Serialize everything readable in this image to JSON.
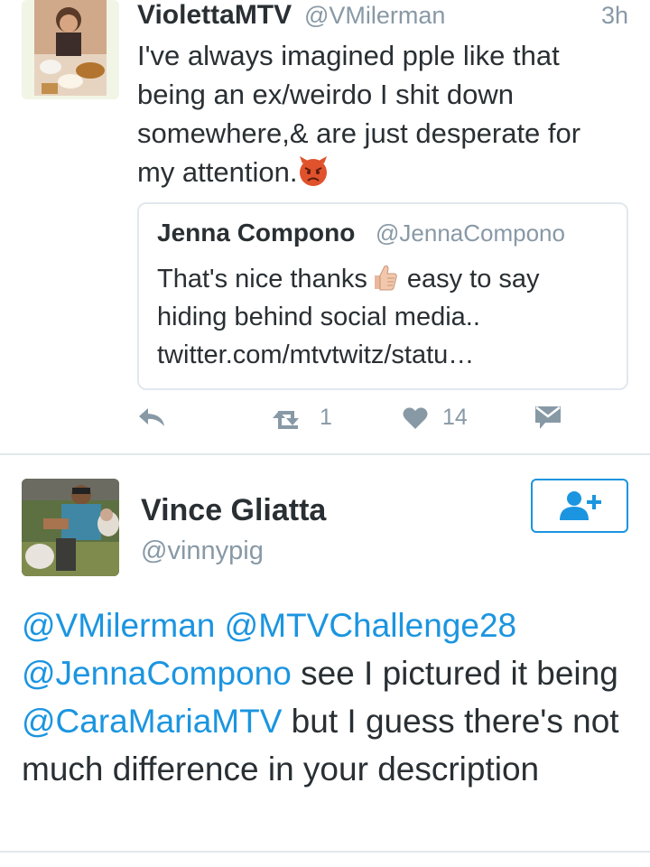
{
  "tweet1": {
    "author_name": "ViolettaMTV",
    "author_handle": "@VMilerman",
    "time": "3h",
    "text": "I've always imagined pple like that being an ex/weirdo I shit down somewhere,& are just desperate for my attention.",
    "emoji": "angry-face-emoji",
    "quoted": {
      "author_name": "Jenna Compono",
      "author_handle": "@JennaCompono",
      "text_before_emoji": "That's nice thanks",
      "emoji": "thumbs-up-emoji",
      "text_after_emoji": "easy to say hiding behind social media.. twitter.com/mtvtwitz/statu…"
    },
    "actions": {
      "reply_icon": "reply-icon",
      "retweet_icon": "retweet-icon",
      "retweet_count": "1",
      "like_icon": "heart-icon",
      "like_count": "14",
      "message_icon": "direct-message-icon"
    }
  },
  "tweet2": {
    "author_name": "Vince Gliatta",
    "author_handle": "@vinnypig",
    "follow_icon": "follow-person-plus-icon",
    "text_parts": [
      {
        "text": "@VMilerman",
        "mention": true
      },
      {
        "text": " ",
        "mention": false
      },
      {
        "text": "@MTVChallenge28",
        "mention": true
      },
      {
        "text": " ",
        "mention": false
      },
      {
        "text": "@JennaCompono",
        "mention": true
      },
      {
        "text": " see I pictured it being ",
        "mention": false
      },
      {
        "text": "@CaraMariaMTV",
        "mention": true
      },
      {
        "text": " but I guess there's not much difference in your description",
        "mention": false
      }
    ]
  },
  "colors": {
    "text": "#292f33",
    "muted": "#8899a6",
    "link": "#1b95e0",
    "divider": "#e1e8ed"
  }
}
